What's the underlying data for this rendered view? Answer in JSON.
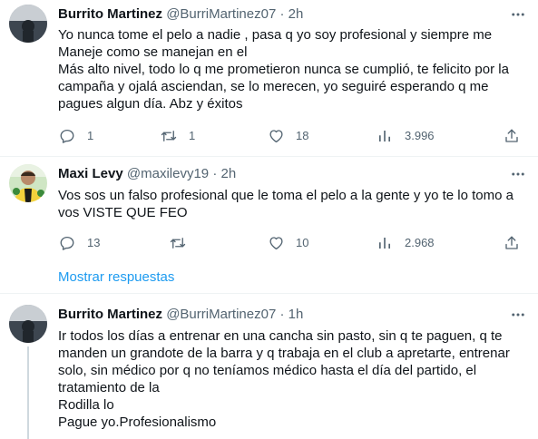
{
  "tweets": [
    {
      "name": "Burrito Martinez",
      "handle": "@BurriMartinez07",
      "separator": "·",
      "time": "2h",
      "lines": [
        "Yo nunca tome el pelo a nadie , pasa q  yo soy profesional y siempre me",
        "Maneje como se manejan en el",
        "Más alto nivel, todo lo q me prometieron nunca se cumplió, te felicito por la",
        "campaña y ojalá asciendan, se lo merecen, yo seguiré esperando q me",
        "pagues algun día. Abz y éxitos"
      ],
      "reply_count": "1",
      "retweet_count": "1",
      "like_count": "18",
      "view_count": "3.996"
    },
    {
      "name": "Maxi Levy",
      "handle": "@maxilevy19",
      "separator": "·",
      "time": "2h",
      "lines": [
        "Vos sos un falso profesional que le toma el pelo a la gente y yo te lo tomo a",
        "vos VISTE QUE FEO"
      ],
      "reply_count": "13",
      "retweet_count": "",
      "like_count": "10",
      "view_count": "2.968"
    },
    {
      "name": "Burrito Martinez",
      "handle": "@BurriMartinez07",
      "separator": "·",
      "time": "1h",
      "lines": [
        "Ir todos los días a entrenar en una cancha sin pasto, sin q te paguen, q te",
        "manden un grandote de la barra y q trabaja en el club a apretarte, entrenar",
        "solo, sin médico por q no teníamos médico hasta el día del partido, el",
        "tratamiento de la",
        "Rodilla lo",
        "Pague yo.Profesionalismo"
      ]
    }
  ],
  "show_replies_label": "Mostrar respuestas",
  "icons": {
    "reply": "reply-icon",
    "retweet": "retweet-icon",
    "like": "heart-icon",
    "views": "views-icon",
    "share": "share-icon",
    "more": "more-icon"
  },
  "colors": {
    "link": "#1d9bf0",
    "secondary_text": "#536471",
    "divider": "#eff3f4"
  }
}
